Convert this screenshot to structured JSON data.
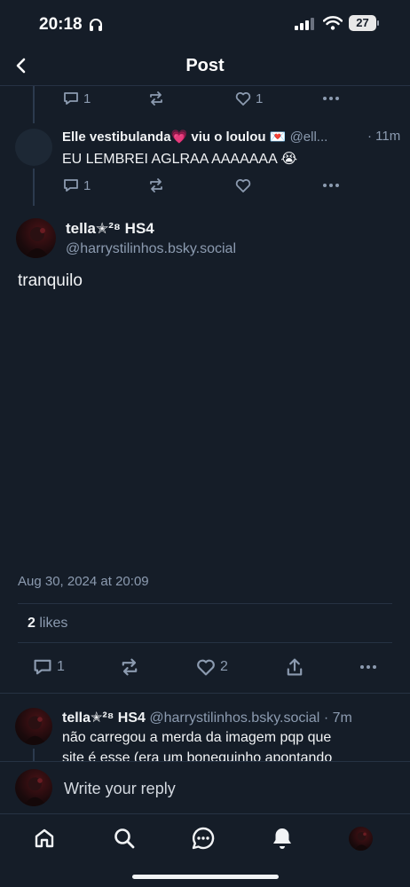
{
  "status_bar": {
    "time": "20:18",
    "battery": "27"
  },
  "header": {
    "title": "Post"
  },
  "thread_top": {
    "reply_count": "1",
    "like_count": "1"
  },
  "reply_elle": {
    "display_name": "Elle vestibulanda💗 viu o loulou 💌",
    "handle": "@ell...",
    "time": "· 11m",
    "text": "EU LEMBREI AGLRAA AAAAAAA 😭",
    "reply_count": "1"
  },
  "main_post": {
    "display_name": "tella✭²⁸ HS4",
    "handle": "@harrystilinhos.bsky.social",
    "text": "tranquilo",
    "timestamp": "Aug 30, 2024 at 20:09",
    "likes_count": "2",
    "likes_label": "likes",
    "reply_count": "1",
    "like_count": "2"
  },
  "reply_tella": {
    "display_name": "tella✭²⁸ HS4",
    "handle": "@harrystilinhos.bsky.social",
    "time": "· 7m",
    "text_line1": "não carregou a merda da imagem pqp que",
    "text_line2": "site é esse (era um boneguinho apontando"
  },
  "composer": {
    "placeholder": "Write your reply"
  },
  "colors": {
    "background": "#151d28",
    "muted": "#8c9bb0",
    "divider": "#263243"
  }
}
